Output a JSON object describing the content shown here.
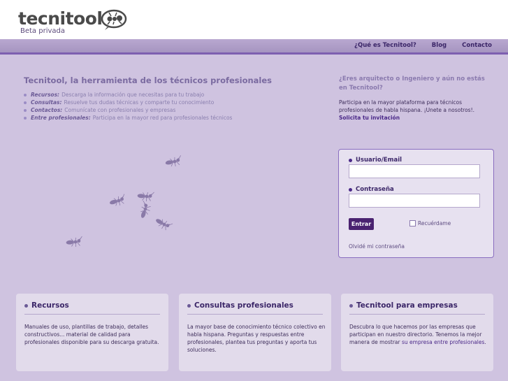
{
  "header": {
    "logo": "tecnitool",
    "subtitle": "Beta privada",
    "nav": [
      "¿Qué es Tecnitool?",
      "Blog",
      "Contacto"
    ]
  },
  "intro": {
    "title": "Tecnitool, la herramienta de los técnicos profesionales",
    "features": [
      {
        "key": "Recursos:",
        "text": "Descarga la información que necesitas para tu trabajo"
      },
      {
        "key": "Consultas:",
        "text": "Resuelve tus dudas técnicas y comparte tu conocimiento"
      },
      {
        "key": "Contactos:",
        "text": "Comunícate con profesionales y empresas"
      },
      {
        "key": "Entre profesionales:",
        "text": "Participa en la mayor red para profesionales técnicos"
      }
    ]
  },
  "promo": {
    "title": "¿Eres arquitecto o Ingeniero y aún no estás en Tecnitool?",
    "text": "Participa en la mayor plataforma para técnicos profesionales de habla hispana. ¡Unete a nosotros!.",
    "link": "Solicita tu invitación"
  },
  "login": {
    "user_label": "Usuario/Email",
    "pass_label": "Contraseña",
    "submit": "Entrar",
    "remember": "Recuérdame",
    "forgot": "Olvidé mi contraseña"
  },
  "cards": [
    {
      "title": "Recursos",
      "text": "Manuales de uso, plantillas de trabajo, detalles constructivos... material de calidad para profesionales disponible para su descarga gratuita.",
      "link": ""
    },
    {
      "title": "Consultas profesionales",
      "text": "La mayor base de conocimiento técnico colectivo en habla hispana. Preguntas y respuestas entre profesionales, plantea tus preguntas y aporta tus soluciones.",
      "link": ""
    },
    {
      "title": "Tecnitool para empresas",
      "text": "Descubra lo que hacemos por las empresas que participan en nuestro directorio. Tenemos la mejor manera de mostrar ",
      "link": "su empresa entre profesionales",
      "tail": "."
    }
  ],
  "colors": {
    "brand": "#4a2270",
    "background": "#cfc3e0"
  }
}
